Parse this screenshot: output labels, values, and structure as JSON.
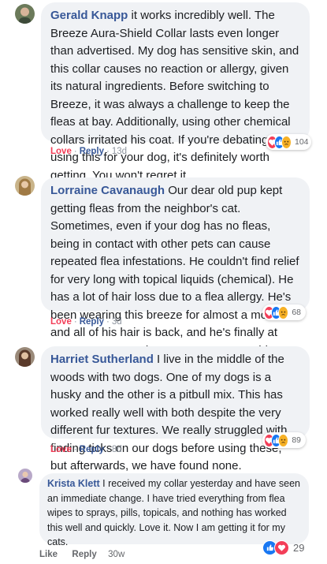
{
  "comments": [
    {
      "author": "Gerald Knapp",
      "text": "it works incredibly well. The Breeze Aura-Shield Collar lasts even longer than advertised. My dog has sensitive skin, and this collar causes no reaction or allergy, given its natural ingredients. Before switching to Breeze, it was always a challenge to keep the fleas at bay. Additionally, using other chemical collars irritated his coat. If you're debating on using this for your dog, it's definitely worth getting. You won't regret it.",
      "love_label": "Love",
      "reply_label": "Reply",
      "time": "13d",
      "reaction_count": "104",
      "avatar_color": "#6b7a5a"
    },
    {
      "author": "Lorraine Cavanaugh",
      "text": "Our dear old pup kept getting fleas from the neighbor's cat. Sometimes, even if your dog has no fleas, being in contact with other pets can cause repeated flea infestations. He couldn't find relief for very long with topical liquids (chemical). He has a lot of hair loss due to a flea allergy. He's been wearing this breeze for almost a month, and all of his hair is back, and he's finally at peace. It was worth every penny to see him rest quietly again.",
      "love_label": "Love",
      "reply_label": "Reply",
      "time": "3d",
      "reaction_count": "68",
      "avatar_color": "#b89a6a"
    },
    {
      "author": "Harriet Sutherland",
      "text": "I live in the middle of the woods with two dogs. One of my dogs is a husky and the other is a pitbull mix. This has worked really well with both despite the very different fur textures. We really struggled with finding ticks on our dogs before using these, but afterwards, we have found none.",
      "love_label": "Love",
      "reply_label": "Reply",
      "time": "8d",
      "reaction_count": "89",
      "avatar_color": "#7b5a4a"
    },
    {
      "author": "Krista Klett",
      "text": "I received my collar yesterday and have seen an immediate change. I have tried everything from flea wipes to sprays, pills, topicals, and nothing has worked this well and quickly. Love it. Now I am getting it for my cats.",
      "like_label": "Like",
      "reply_label": "Reply",
      "time": "30w",
      "reaction_count": "29",
      "avatar_color": "#8a7a9a"
    }
  ],
  "separator": "·"
}
